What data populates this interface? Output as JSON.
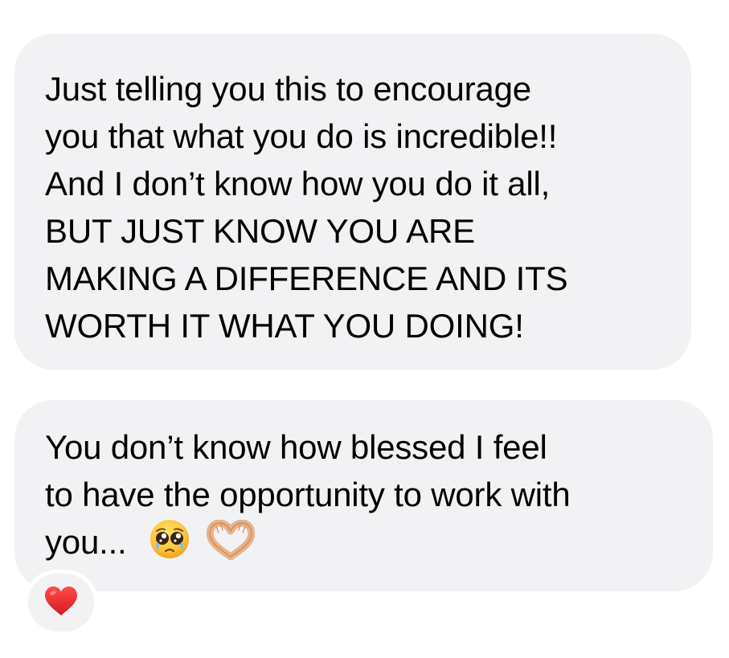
{
  "messages": [
    {
      "lines": [
        "Just telling you this to encourage",
        "you that what you do is incredible!!",
        "And I don’t know how you do it all,",
        "BUT JUST KNOW YOU ARE",
        "MAKING A DIFFERENCE AND ITS",
        "WORTH IT WHAT YOU DOING!"
      ]
    },
    {
      "lines": [
        "You don’t know how blessed I feel",
        "to have the opportunity to work with",
        "you..."
      ],
      "emojis": [
        "pleading-face-with-tears-icon",
        "heart-hands-icon"
      ]
    }
  ],
  "reaction": {
    "icon": "red-heart-icon",
    "color": "#e0242c"
  },
  "colors": {
    "bubble": "#f2f2f5",
    "text": "#000000",
    "background": "#ffffff"
  }
}
